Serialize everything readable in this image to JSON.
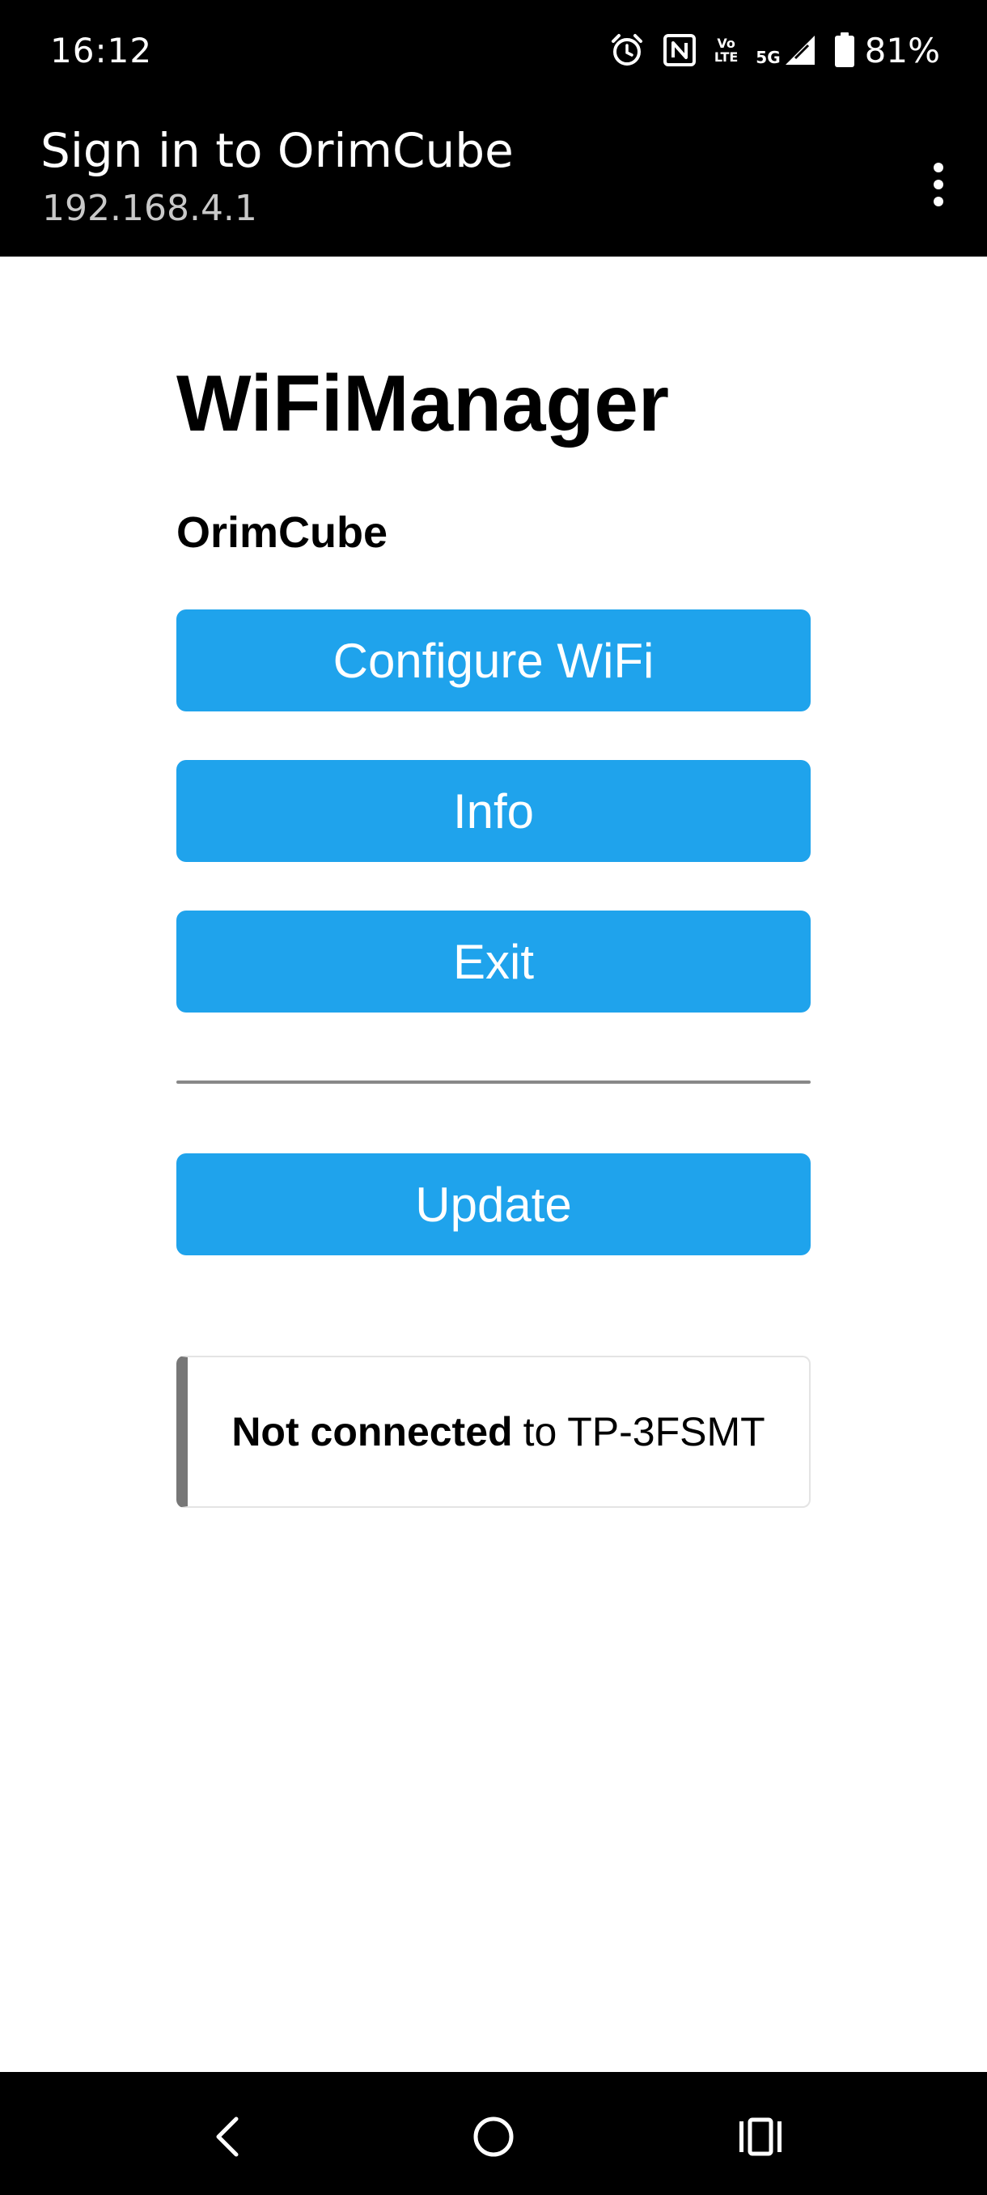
{
  "status_bar": {
    "time": "16:12",
    "icons": [
      "alarm-icon",
      "nfc-icon",
      "volte-icon",
      "signal-5g-icon",
      "battery-icon"
    ],
    "volte_label_top": "Vo",
    "volte_label_bottom": "LTE",
    "network_label": "5G",
    "battery_percent": "81%"
  },
  "app_bar": {
    "title": "Sign in to OrimCube",
    "subtitle": "192.168.4.1",
    "menu_icon": "more-vert-icon"
  },
  "page": {
    "title": "WiFiManager",
    "device_name": "OrimCube",
    "buttons": {
      "configure_wifi": "Configure WiFi",
      "info": "Info",
      "exit": "Exit",
      "update": "Update"
    },
    "status_message": {
      "bold": "Not connected",
      "rest": "to TP-3FSMT"
    }
  },
  "nav_bar": {
    "icons": [
      "back-icon",
      "home-icon",
      "recents-icon"
    ]
  },
  "colors": {
    "button": "#1fa3ec",
    "bars": "#000000",
    "status_border": "#777777"
  }
}
